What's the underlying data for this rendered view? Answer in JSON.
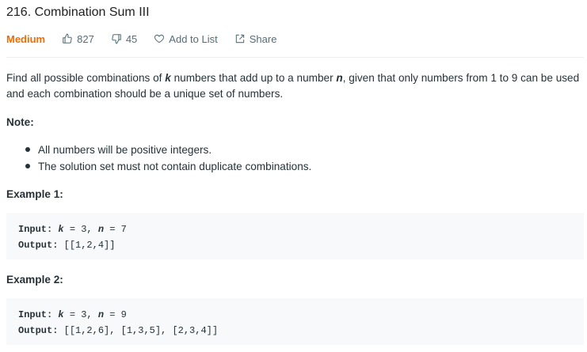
{
  "problem": {
    "title": "216. Combination Sum III",
    "difficulty": "Medium",
    "likes": "827",
    "dislikes": "45",
    "add_to_list_label": "Add to List",
    "share_label": "Share"
  },
  "description": {
    "part1": "Find all possible combinations of ",
    "var_k": "k",
    "part2": " numbers that add up to a number ",
    "var_n": "n",
    "part3": ", given that only numbers from 1 to 9 can be used and each combination should be a unique set of numbers."
  },
  "note": {
    "heading": "Note:",
    "items": [
      "All numbers will be positive integers.",
      "The solution set must not contain duplicate combinations."
    ]
  },
  "examples": [
    {
      "heading": "Example 1:",
      "input_label": "Input:",
      "k_name": "k",
      "k_rest": " = 3, ",
      "n_name": "n",
      "n_rest": " = 7",
      "output_label": "Output:",
      "output_value": " [[1,2,4]]"
    },
    {
      "heading": "Example 2:",
      "input_label": "Input:",
      "k_name": "k",
      "k_rest": " = 3, ",
      "n_name": "n",
      "n_rest": " = 9",
      "output_label": "Output:",
      "output_value": " [[1,2,6], [1,3,5], [2,3,4]]"
    }
  ],
  "colors": {
    "difficulty_medium": "#ef6c00",
    "code_background": "#f7f9fa",
    "text": "#263238",
    "muted": "#546e7a"
  },
  "icons": {
    "like": "thumbs-up-icon",
    "dislike": "thumbs-down-icon",
    "add_to_list": "heart-icon",
    "share": "share-icon"
  }
}
